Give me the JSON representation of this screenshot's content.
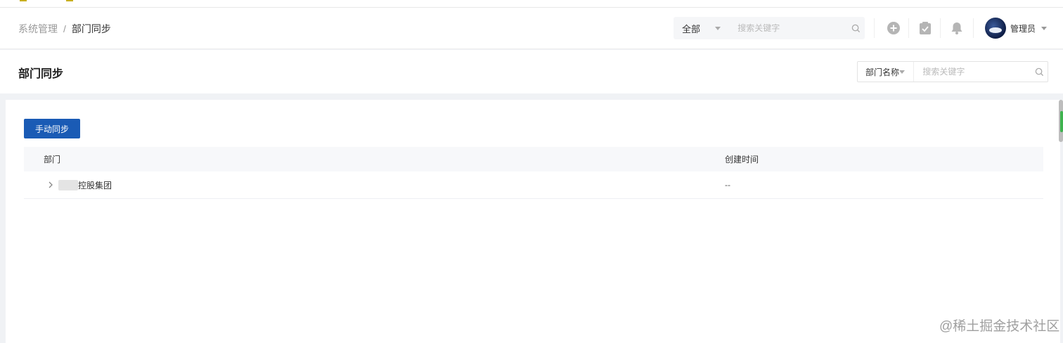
{
  "breadcrumb": {
    "parent": "系统管理",
    "separator": "/",
    "current": "部门同步"
  },
  "global_search": {
    "scope": "全部",
    "placeholder": "搜索关键字"
  },
  "user": {
    "name": "管理员"
  },
  "page": {
    "title": "部门同步"
  },
  "filter": {
    "field": "部门名称",
    "placeholder": "搜索关键字"
  },
  "actions": {
    "sync_label": "手动同步"
  },
  "table": {
    "columns": [
      "部门",
      "创建时间"
    ],
    "rows": [
      {
        "dept": "控股集团",
        "created": "--"
      }
    ]
  },
  "watermark": "@稀土掘金技术社区",
  "colors": {
    "primary": "#1a5bb5",
    "accent_green": "#3fb34f"
  }
}
